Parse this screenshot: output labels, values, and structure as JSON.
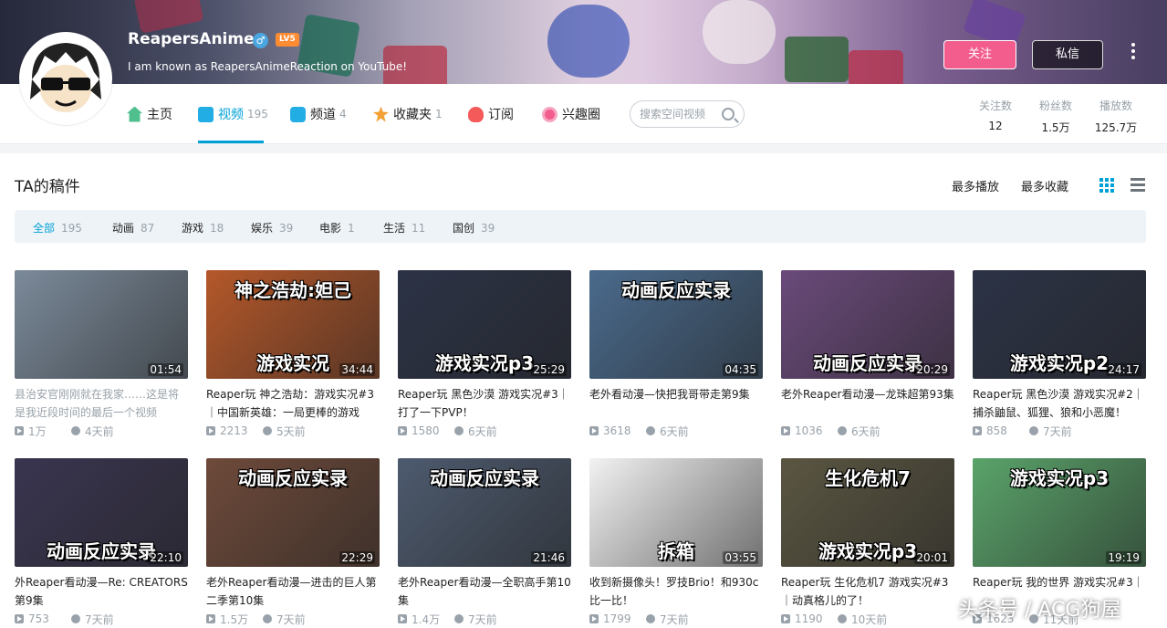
{
  "profile": {
    "name": "ReapersAnime",
    "level": "LV5",
    "verified_glyph": "♂",
    "sign": "I am known as ReapersAnimeReaction on YouTube!",
    "follow_label": "关注",
    "message_label": "私信"
  },
  "nav": {
    "items": [
      {
        "label": "主页",
        "count": "",
        "icon": "home-icon",
        "color": "#4fc08d"
      },
      {
        "label": "视频",
        "count": "195",
        "icon": "video-icon",
        "color": "#23ade5"
      },
      {
        "label": "频道",
        "count": "4",
        "icon": "channel-icon",
        "color": "#23ade5"
      },
      {
        "label": "收藏夹",
        "count": "1",
        "icon": "star-icon",
        "color": "#f3a034"
      },
      {
        "label": "订阅",
        "count": "",
        "icon": "heart-icon",
        "color": "#f45a5a"
      },
      {
        "label": "兴趣圈",
        "count": "",
        "icon": "circle-icon",
        "color": "#f25d8e"
      }
    ],
    "search_placeholder": "搜索空间视频"
  },
  "stats": [
    {
      "label": "关注数",
      "value": "12"
    },
    {
      "label": "粉丝数",
      "value": "1.5万"
    },
    {
      "label": "播放数",
      "value": "125.7万"
    }
  ],
  "section": {
    "title": "TA的稿件",
    "sort_most_played": "最多播放",
    "sort_most_fav": "最多收藏"
  },
  "filters": [
    {
      "label": "全部",
      "count": "195"
    },
    {
      "label": "动画",
      "count": "87"
    },
    {
      "label": "游戏",
      "count": "18"
    },
    {
      "label": "娱乐",
      "count": "39"
    },
    {
      "label": "电影",
      "count": "1"
    },
    {
      "label": "生活",
      "count": "11"
    },
    {
      "label": "国创",
      "count": "39"
    }
  ],
  "videos": [
    {
      "caption": "",
      "top_caption": "",
      "duration": "01:54",
      "title": "县治安官刚刚就在我家……这是将是我近段时间的最后一个视频了……",
      "plays": "1万",
      "time": "4天前",
      "bg": "#7b8a9a",
      "dim": true
    },
    {
      "caption": "游戏实况",
      "top_caption": "神之浩劫:妲己",
      "duration": "34:44",
      "title": "Reaper玩 神之浩劫：游戏实况#3｜中国新英雄：一局更棒的游戏",
      "plays": "2213",
      "time": "5天前",
      "bg": "#b5582a",
      "dim": false
    },
    {
      "caption": "游戏实况p3",
      "top_caption": "",
      "duration": "25:29",
      "title": "Reaper玩 黑色沙漠 游戏实况#3｜打了一下PVP！",
      "plays": "1580",
      "time": "6天前",
      "bg": "#2c3346",
      "dim": false
    },
    {
      "caption": "",
      "top_caption": "动画反应实录",
      "duration": "04:35",
      "title": "老外看动漫—快把我哥带走第9集",
      "plays": "3618",
      "time": "6天前",
      "bg": "#4a6a8c",
      "dim": false
    },
    {
      "caption": "动画反应实录",
      "top_caption": "",
      "duration": "20:29",
      "title": "老外Reaper看动漫—龙珠超第93集",
      "plays": "1036",
      "time": "6天前",
      "bg": "#6a4a7a",
      "dim": false
    },
    {
      "caption": "游戏实况p2",
      "top_caption": "",
      "duration": "24:17",
      "title": "Reaper玩 黑色沙漠 游戏实况#2｜捕杀鼬鼠、狐狸、狼和小恶魔！",
      "plays": "858",
      "time": "7天前",
      "bg": "#2c3346",
      "dim": false
    },
    {
      "caption": "动画反应实录",
      "top_caption": "",
      "duration": "22:10",
      "title": "外Reaper看动漫—Re: CREATORS第9集",
      "plays": "753",
      "time": "7天前",
      "bg": "#3a3550",
      "dim": false
    },
    {
      "caption": "",
      "top_caption": "动画反应实录",
      "duration": "22:29",
      "title": "老外Reaper看动漫—进击的巨人第二季第10集",
      "plays": "1.5万",
      "time": "7天前",
      "bg": "#6e4a3a",
      "dim": false
    },
    {
      "caption": "",
      "top_caption": "动画反应实录",
      "duration": "21:46",
      "title": "老外Reaper看动漫—全职高手第10集",
      "plays": "1.4万",
      "time": "7天前",
      "bg": "#4d5a6e",
      "dim": false
    },
    {
      "caption": "拆箱",
      "top_caption": "",
      "duration": "03:55",
      "title": "收到新摄像头！罗技Brio！和930c比一比！",
      "plays": "1799",
      "time": "7天前",
      "bg": "#f2f2f2",
      "dim": false
    },
    {
      "caption": "游戏实况p3",
      "top_caption": "生化危机7",
      "duration": "20:01",
      "title": "Reaper玩 生化危机7 游戏实况#3｜动真格儿的了！",
      "plays": "1190",
      "time": "10天前",
      "bg": "#5b5642",
      "dim": false
    },
    {
      "caption": "",
      "top_caption": "游戏实况p3",
      "duration": "19:19",
      "title": "Reaper玩 我的世界 游戏实况#3｜",
      "plays": "1623",
      "time": "11天前",
      "bg": "#5aa36a",
      "dim": false
    }
  ],
  "watermark": "头条号 / ACG狗屋",
  "colors": {
    "accent": "#00a1d6",
    "follow": "#f25d8e"
  }
}
